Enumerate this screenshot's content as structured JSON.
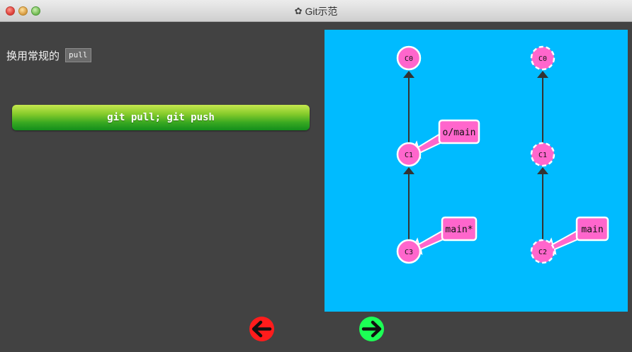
{
  "window": {
    "title": "Git示范",
    "title_icon": "gear-icon"
  },
  "instruction": {
    "text": "换用常规的",
    "code": "pull"
  },
  "command_bar": {
    "text": "git pull; git push",
    "colors": {
      "top": "#c6e84f",
      "bottom": "#138e1c"
    }
  },
  "visualization": {
    "background": "#00bbff",
    "node_color": "#ff66cc",
    "branch_color": "#ff66cc",
    "remote_repo": {
      "commits": [
        "C0",
        "C1",
        "C3"
      ],
      "branches": [
        {
          "label": "o/main",
          "points_to": "C1"
        },
        {
          "label": "main*",
          "points_to": "C3"
        }
      ]
    },
    "local_repo": {
      "commits": [
        "C0",
        "C1",
        "C2"
      ],
      "dashed_outline": true,
      "branches": [
        {
          "label": "main",
          "points_to": "C2"
        }
      ]
    }
  },
  "navigation": {
    "prev_icon": "arrow-left-icon",
    "next_icon": "arrow-right-icon",
    "prev_color": "#ff1c1c",
    "next_color": "#1cff55"
  }
}
